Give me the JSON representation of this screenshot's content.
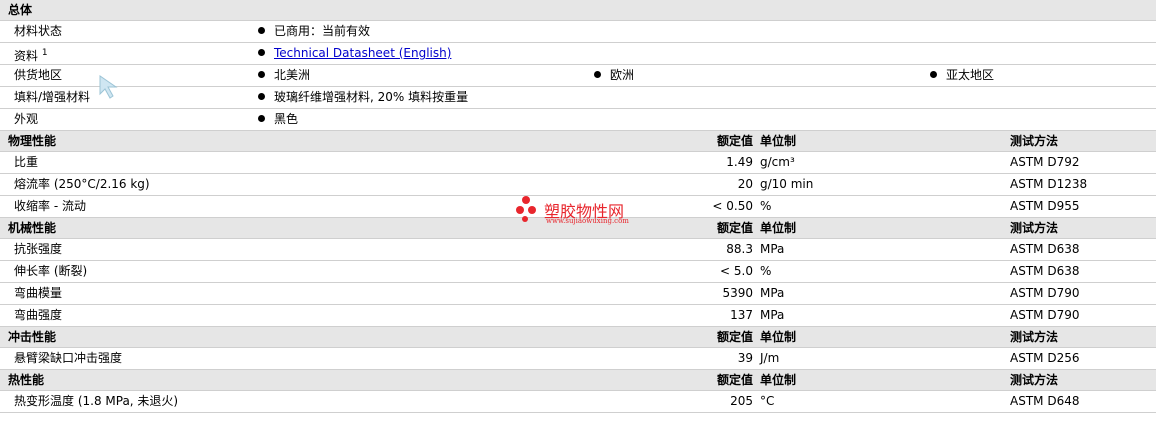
{
  "sections": {
    "general": {
      "title": "总体",
      "rows": {
        "material_status": {
          "label": "材料状态",
          "value": "已商用：当前有效"
        },
        "documents": {
          "label": "资料",
          "sup": "1",
          "link": "Technical Datasheet (English)"
        },
        "availability": {
          "label": "供货地区",
          "regions": [
            "北美洲",
            "欧洲",
            "亚太地区"
          ]
        },
        "filler": {
          "label": "填料/增强材料",
          "value": "玻璃纤维增强材料, 20% 填料按重量"
        },
        "appearance": {
          "label": "外观",
          "value": "黑色"
        }
      }
    },
    "columns": {
      "value": "额定值",
      "unit": "单位制",
      "method": "测试方法"
    },
    "physical": {
      "title": "物理性能",
      "rows": [
        {
          "label": "比重",
          "value": "1.49",
          "unit": "g/cm³",
          "method": "ASTM D792"
        },
        {
          "label": "熔流率 (250°C/2.16 kg)",
          "value": "20",
          "unit": "g/10 min",
          "method": "ASTM D1238"
        },
        {
          "label": "收缩率 - 流动",
          "value": "< 0.50",
          "unit": "%",
          "method": "ASTM D955"
        }
      ]
    },
    "mechanical": {
      "title": "机械性能",
      "rows": [
        {
          "label": "抗张强度",
          "value": "88.3",
          "unit": "MPa",
          "method": "ASTM D638"
        },
        {
          "label": "伸长率 (断裂)",
          "value": "< 5.0",
          "unit": "%",
          "method": "ASTM D638"
        },
        {
          "label": "弯曲模量",
          "value": "5390",
          "unit": "MPa",
          "method": "ASTM D790"
        },
        {
          "label": "弯曲强度",
          "value": "137",
          "unit": "MPa",
          "method": "ASTM D790"
        }
      ]
    },
    "impact": {
      "title": "冲击性能",
      "rows": [
        {
          "label": "悬臂梁缺口冲击强度",
          "value": "39",
          "unit": "J/m",
          "method": "ASTM D256"
        }
      ]
    },
    "thermal": {
      "title": "热性能",
      "rows": [
        {
          "label": "热变形温度 (1.8 MPa, 未退火)",
          "value": "205",
          "unit": "°C",
          "method": "ASTM D648"
        }
      ]
    }
  },
  "watermark": {
    "title": "塑胶物性网",
    "url": "www.sujiaowuxing.com",
    "color": "#e8262d"
  },
  "icons": {
    "bullet": "bullet-dot-icon",
    "cursor": "mouse-cursor-icon"
  }
}
